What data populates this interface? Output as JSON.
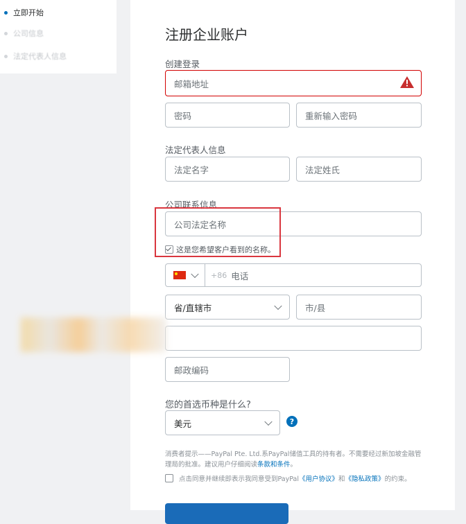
{
  "sidebar": {
    "steps": [
      {
        "label": "立即开始",
        "state": "active"
      },
      {
        "label": "公司信息",
        "state": "pending"
      },
      {
        "label": "法定代表人信息",
        "state": "pending"
      }
    ]
  },
  "form": {
    "title": "注册企业账户",
    "login": {
      "heading": "创建登录",
      "email_placeholder": "邮箱地址",
      "password_placeholder": "密码",
      "confirm_password_placeholder": "重新输入密码"
    },
    "representative": {
      "heading": "法定代表人信息",
      "first_name_placeholder": "法定名字",
      "last_name_placeholder": "法定姓氏"
    },
    "company": {
      "heading": "公司联系信息",
      "name_placeholder": "公司法定名称",
      "display_name_checkbox_label": "这是您希望客户看到的名称。",
      "display_name_checked": true,
      "country_code": "+86",
      "phone_placeholder": "电话",
      "province_select": "省/直辖市",
      "city_placeholder": "市/县",
      "postal_code_placeholder": "邮政编码"
    },
    "currency": {
      "question": "您的首选币种是什么?",
      "selected": "美元",
      "help_symbol": "?"
    },
    "notice": {
      "text": "消费者提示——PayPal Pte. Ltd.系PayPal储值工具的持有者。不需要经过新加坡金融管理局的批准。建议用户仔细阅读",
      "link": "条款和条件",
      "end": "。"
    },
    "agreement": {
      "checked": false,
      "prefix": "点击同意并继续即表示我同意受到PayPal",
      "link1": "《用户协议》",
      "middle": "和",
      "link2": "《隐私政策》",
      "suffix": "的约束。"
    }
  },
  "colors": {
    "accent": "#0070ba",
    "error": "#d20000",
    "highlight": "#d9363e",
    "submit": "#1a6bb8"
  }
}
